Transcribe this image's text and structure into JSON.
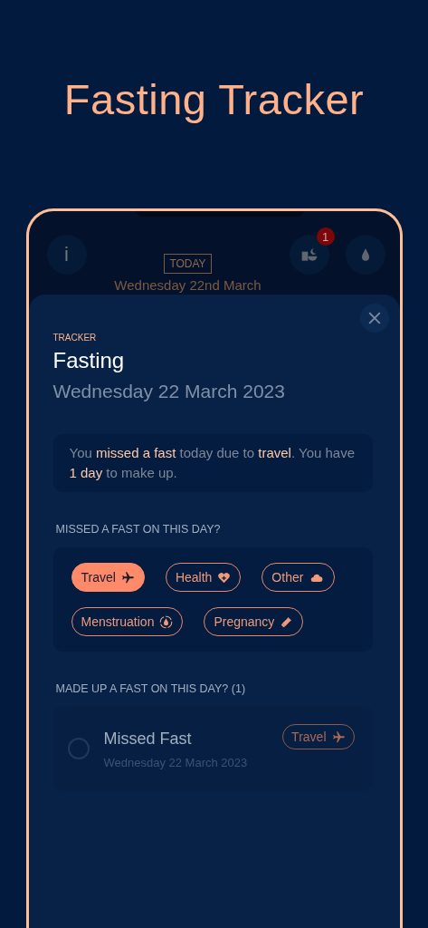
{
  "page_title": "Fasting Tracker",
  "header": {
    "today_label": "TODAY",
    "date_partial": "Wednesday 22nd March",
    "badge_count": "1",
    "info_glyph": "i"
  },
  "sheet": {
    "eyebrow": "TRACKER",
    "title": "Fasting",
    "date": "Wednesday 22 March 2023",
    "message": "You **missed a fast** today due to **travel**. You have **1 day** to make up.",
    "missed_heading": "MISSED A FAST ON THIS DAY?",
    "reasons": [
      {
        "label": "Travel",
        "selected": true
      },
      {
        "label": "Health",
        "selected": false
      },
      {
        "label": "Other",
        "selected": false
      },
      {
        "label": "Menstruation",
        "selected": false
      },
      {
        "label": "Pregnancy",
        "selected": false
      }
    ],
    "made_up_heading": "MADE UP A FAST ON THIS DAY? (1)",
    "made_up": [
      {
        "title": "Missed Fast",
        "date": "Wednesday 22 March 2023",
        "tag": "Travel",
        "checked": false
      }
    ]
  }
}
